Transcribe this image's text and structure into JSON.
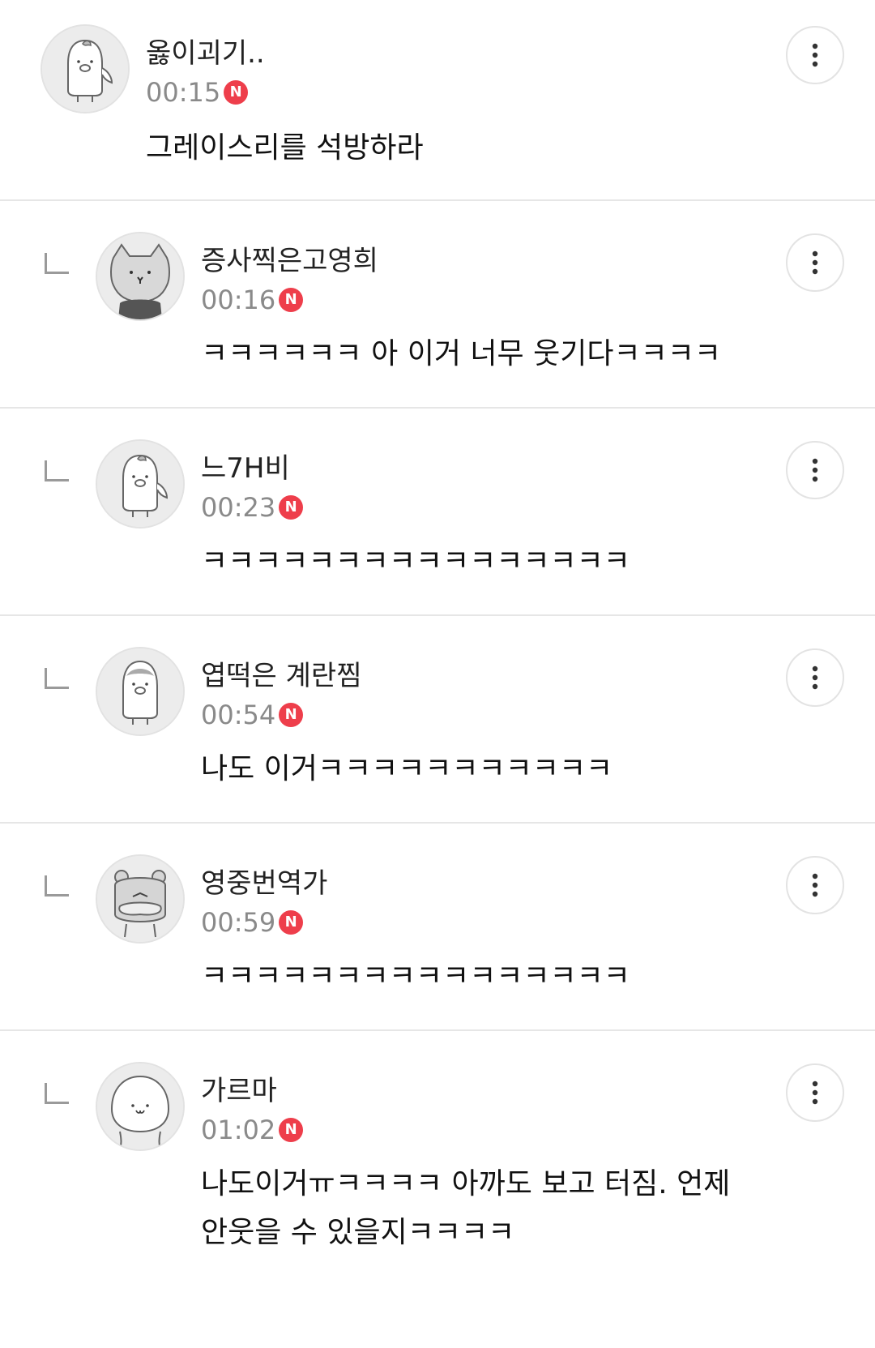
{
  "comments": [
    {
      "nickname": "옳이괴기..",
      "time": "00:15",
      "badge": "N",
      "text": "그레이스리를 석방하라",
      "avatar_icon": "penguin-leaf-icon",
      "is_reply": false
    },
    {
      "nickname": "증사찍은고영희",
      "time": "00:16",
      "badge": "N",
      "text": "ㅋㅋㅋㅋㅋㅋ 아 이거 너무 웃기다ㅋㅋㅋㅋ",
      "avatar_icon": "cat-icon",
      "is_reply": true
    },
    {
      "nickname": "느7H비",
      "time": "00:23",
      "badge": "N",
      "text": "ㅋㅋㅋㅋㅋㅋㅋㅋㅋㅋㅋㅋㅋㅋㅋㅋ",
      "avatar_icon": "penguin-leaf-icon",
      "is_reply": true
    },
    {
      "nickname": "엽떡은 계란찜",
      "time": "00:54",
      "badge": "N",
      "text": "나도 이거ㅋㅋㅋㅋㅋㅋㅋㅋㅋㅋㅋ",
      "avatar_icon": "penguin-icon",
      "is_reply": true
    },
    {
      "nickname": "영중번역가",
      "time": "00:59",
      "badge": "N",
      "text": "ㅋㅋㅋㅋㅋㅋㅋㅋㅋㅋㅋㅋㅋㅋㅋㅋ",
      "avatar_icon": "bear-icon",
      "is_reply": true
    },
    {
      "nickname": "가르마",
      "time": "01:02",
      "badge": "N",
      "text_line1": "나도이거ㅠㅋㅋㅋㅋ 아까도 보고 터짐. 언제",
      "text_line2": "안웃을 수 있을지ㅋㅋㅋㅋ",
      "avatar_icon": "round-face-icon",
      "is_reply": true
    }
  ],
  "colors": {
    "badge": "#ee3e4b",
    "time": "#8a8a8a",
    "divider": "#e6e6e6"
  }
}
